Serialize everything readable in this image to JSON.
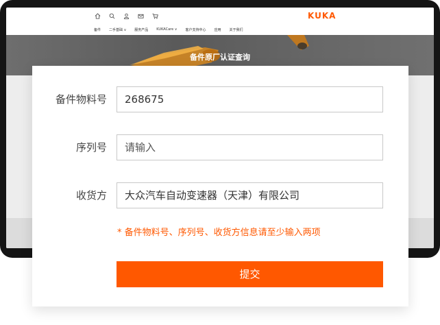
{
  "brand": {
    "logo": "KUKA",
    "accent": "#ff5800"
  },
  "top_icons": [
    "home-icon",
    "search-icon",
    "user-icon",
    "mail-icon",
    "cart-icon"
  ],
  "nav": {
    "items": [
      "备件",
      "二手基础 ∨",
      "服务产品",
      "KUKACare ∨",
      "客户支持中心",
      "应用",
      "关于我们"
    ]
  },
  "hero": {
    "title": "备件原厂认证查询"
  },
  "form": {
    "part_number": {
      "label": "备件物料号",
      "value": "268675"
    },
    "serial_number": {
      "label": "序列号",
      "placeholder": "请输入"
    },
    "consignee": {
      "label": "收货方",
      "value": "大众汽车自动变速器（天津）有限公司"
    },
    "hint": "*  备件物料号、序列号、收货方信息请至少输入两项",
    "submit_label": "提交"
  }
}
